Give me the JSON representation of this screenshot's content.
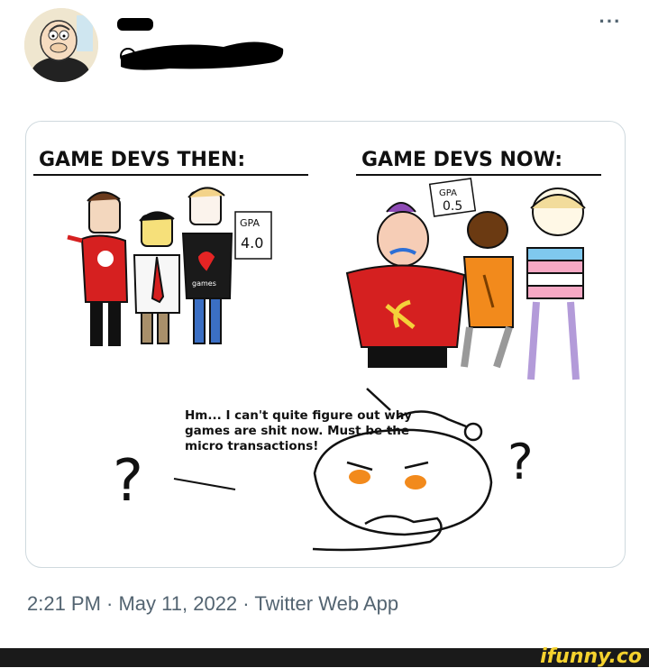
{
  "tweet": {
    "menu_label": "···",
    "timestamp": "2:21 PM · May 11, 2022 · Twitter Web App"
  },
  "comic": {
    "heading_left": "GAME DEVS THEN:",
    "heading_right": "GAME DEVS NOW:",
    "gpa_then_label": "GPA",
    "gpa_then_value": "4.0",
    "gpa_now_label": "GPA",
    "gpa_now_value": "0.5",
    "shirt_text": "games",
    "caption": "Hm... I can't quite figure out why games are shit now. Must be the micro transactions!"
  },
  "footer": {
    "watermark": "ifunny.co"
  },
  "colors": {
    "text_secondary": "#536471",
    "card_border": "#cfd9de",
    "redaction": "#000000",
    "watermark": "#f5d22e"
  }
}
